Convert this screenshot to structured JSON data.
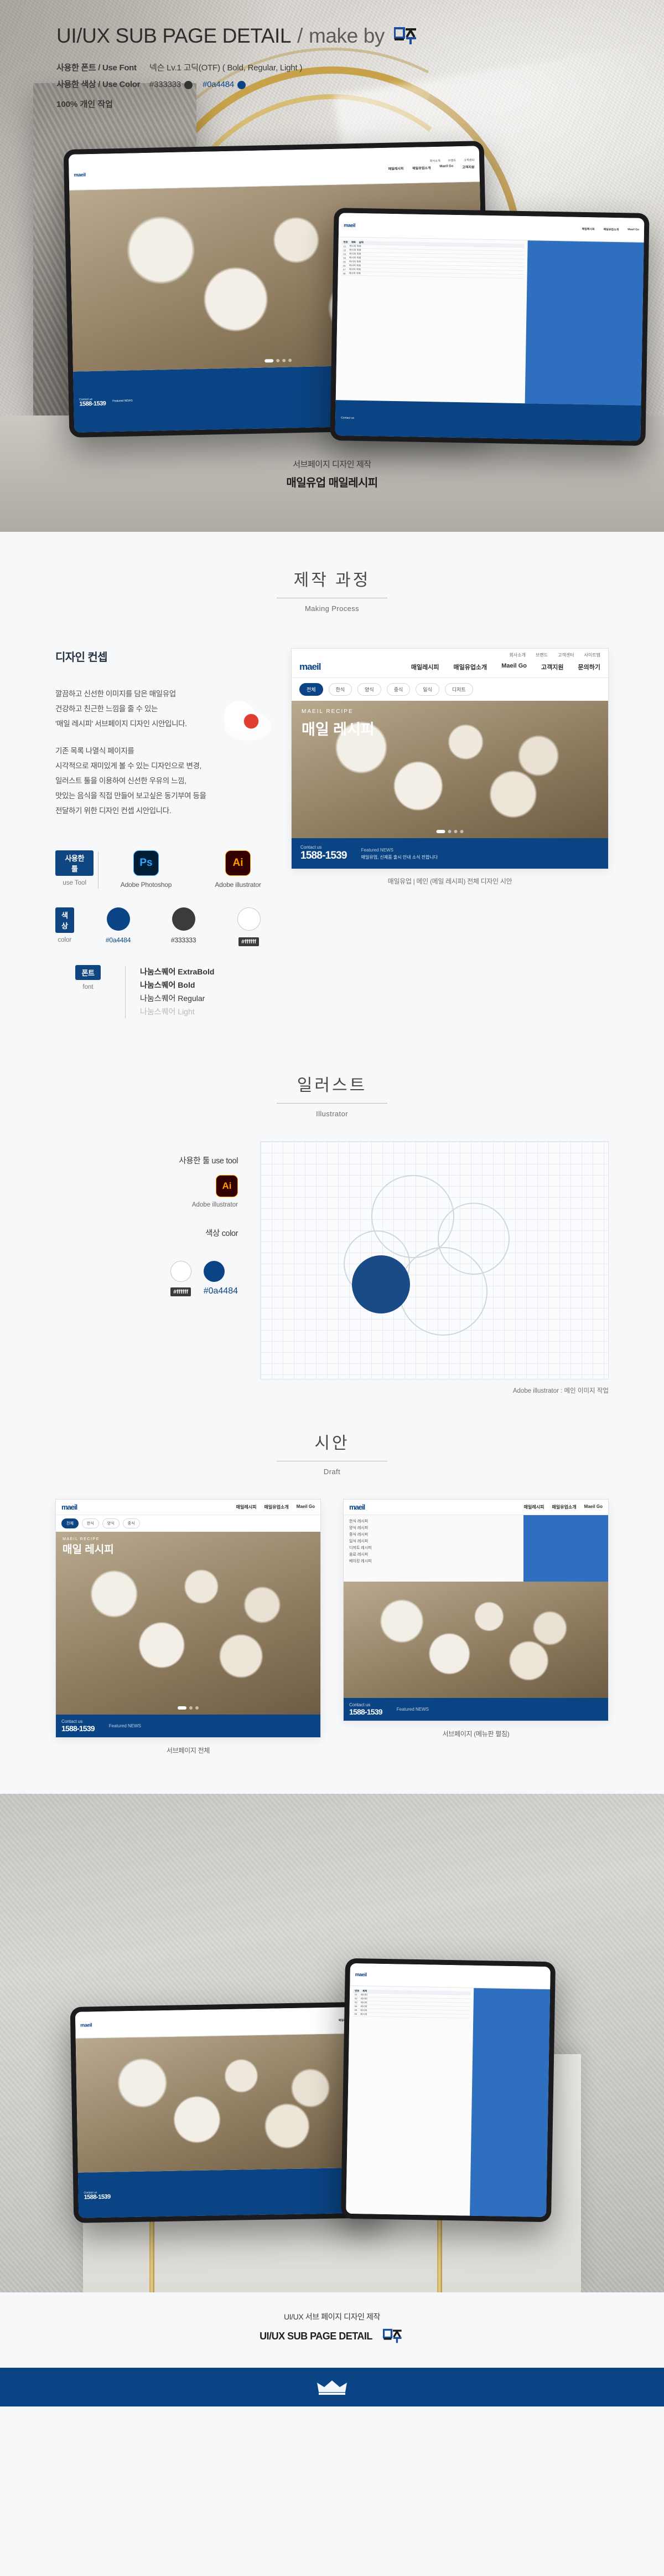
{
  "header": {
    "title_bold": "UI/UX SUB PAGE DETAIL",
    "title_sep": "/",
    "title_light": "make by",
    "logo_text": "미주",
    "font_label": "사용한 폰트 / Use Font",
    "font_value": "넥슨 Lv.1 고딕(OTF) ( Bold, Regular, Light )",
    "color_label": "사용한 색상 / Use Color",
    "color_value_1": "#333333",
    "color_value_2": "#0a4484",
    "personal": "100% 개인 작업"
  },
  "hero_caption": {
    "line1": "서브페이지 디자인 제작",
    "line2": "매일유업 매일레시피"
  },
  "sections": {
    "making": {
      "ko": "제작 과정",
      "en": "Making Process"
    },
    "illust": {
      "ko": "일러스트",
      "en": "Illustrator"
    },
    "draft": {
      "ko": "시안",
      "en": "Draft"
    }
  },
  "concept": {
    "title": "디자인 컨셉",
    "p1": [
      "깔끔하고 신선한 이미지를 담은 매일유업",
      "건강하고 친근한 느낌을 줄 수 있는",
      "'매일 레시피' 서브페이지 디자인 시안입니다."
    ],
    "p2": [
      "기존 목록 나열식 페이지를",
      "시각적으로 재미있게 볼 수 있는 디자인으로 변경,",
      "일러스트 툴을 이용하여 신선한 우유의 느낌,",
      "맛있는 음식을 직접 만들어 보고싶은 동기부여  등을",
      "전달하기 위한 디자인 컨셉 시안입니다."
    ]
  },
  "specs": {
    "tool": {
      "chip": "사용한 툴",
      "en": "use Tool",
      "items": [
        {
          "icon": "Ps",
          "name": "Adobe Photoshop"
        },
        {
          "icon": "Ai",
          "name": "Adobe illustrator"
        }
      ]
    },
    "color": {
      "chip": "색상",
      "en": "color",
      "items": [
        {
          "hex": "#0a4484",
          "label": "#0a4484"
        },
        {
          "hex": "#333333",
          "label": "#333333"
        },
        {
          "hex": "#ffffff",
          "label": "#ffffff"
        }
      ]
    },
    "font": {
      "chip": "폰트",
      "en": "font",
      "items": [
        "나눔스퀘어 ExtraBold",
        "나눔스퀘어 Bold",
        "나눔스퀘어 Regular",
        "나눔스퀘어 Light"
      ]
    }
  },
  "webmock": {
    "utility": [
      "회사소개",
      "브랜드",
      "고객센터",
      "사이트맵"
    ],
    "logo": "maeil",
    "menu": [
      "매일레시피",
      "매일유업소개",
      "Maeil Go",
      "고객지원",
      "문의하기"
    ],
    "tabs": [
      "전체",
      "한식",
      "양식",
      "중식",
      "일식",
      "디저트"
    ],
    "hero_sub": "MAEIL RECIPE",
    "hero_title": "매일 레시피",
    "contact_label": "Contact us",
    "tel": "1588-1539",
    "news_label": "Featured NEWS",
    "news_text": "매일유업, 신제품 출시 안내 소식 전합니다",
    "dots": 4,
    "caption": "매일유업 | 메인 (메일 레시피) 전체 디자인 시안"
  },
  "illust": {
    "tool_label": "사용한 툴 use tool",
    "tool_icon": "Ai",
    "tool_name": "Adobe illustrator",
    "color_label": "색상 color",
    "colors": [
      {
        "hex": "#ffffff",
        "label": "#ffffff"
      },
      {
        "hex": "#0a4484",
        "label": "#0a4484"
      }
    ],
    "caption": "Adobe illustrator : 메인 이미지 작업"
  },
  "drafts": [
    {
      "caption": "서브페이지 전체"
    },
    {
      "caption": "서브페이지 (메뉴판 펼침)"
    }
  ],
  "footer": {
    "line1": "UI/UX 서브 페이지 디자인 제작",
    "line2": "UI/UX SUB PAGE DETAIL",
    "logo_text": "미주"
  },
  "colors": {
    "brand": "#0a4484",
    "dark": "#333333",
    "white": "#ffffff",
    "page_bg": "#f7f8fa"
  }
}
